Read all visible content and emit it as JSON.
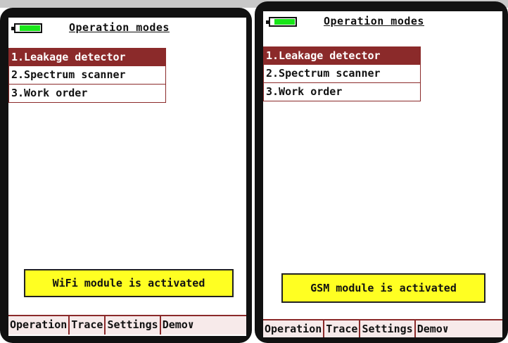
{
  "left": {
    "title": "Operation modes",
    "battery_icon": "battery-icon",
    "menu": [
      {
        "label": "1.Leakage detector",
        "selected": true
      },
      {
        "label": "2.Spectrum scanner",
        "selected": false
      },
      {
        "label": "3.Work order",
        "selected": false
      }
    ],
    "notice": "WiFi module is activated",
    "tabs": [
      "Operation",
      "Trace",
      "Settings",
      "Demo∨"
    ]
  },
  "right": {
    "title": "Operation modes",
    "battery_icon": "battery-icon",
    "menu": [
      {
        "label": "1.Leakage detector",
        "selected": true
      },
      {
        "label": "2.Spectrum scanner",
        "selected": false
      },
      {
        "label": "3.Work order",
        "selected": false
      }
    ],
    "notice": "GSM module is activated",
    "tabs": [
      "Operation",
      "Trace",
      "Settings",
      "Demo∨"
    ]
  },
  "colors": {
    "selected_bg": "#8b2a2a",
    "notice_bg": "#ffff22",
    "battery_fill": "#19e619"
  }
}
